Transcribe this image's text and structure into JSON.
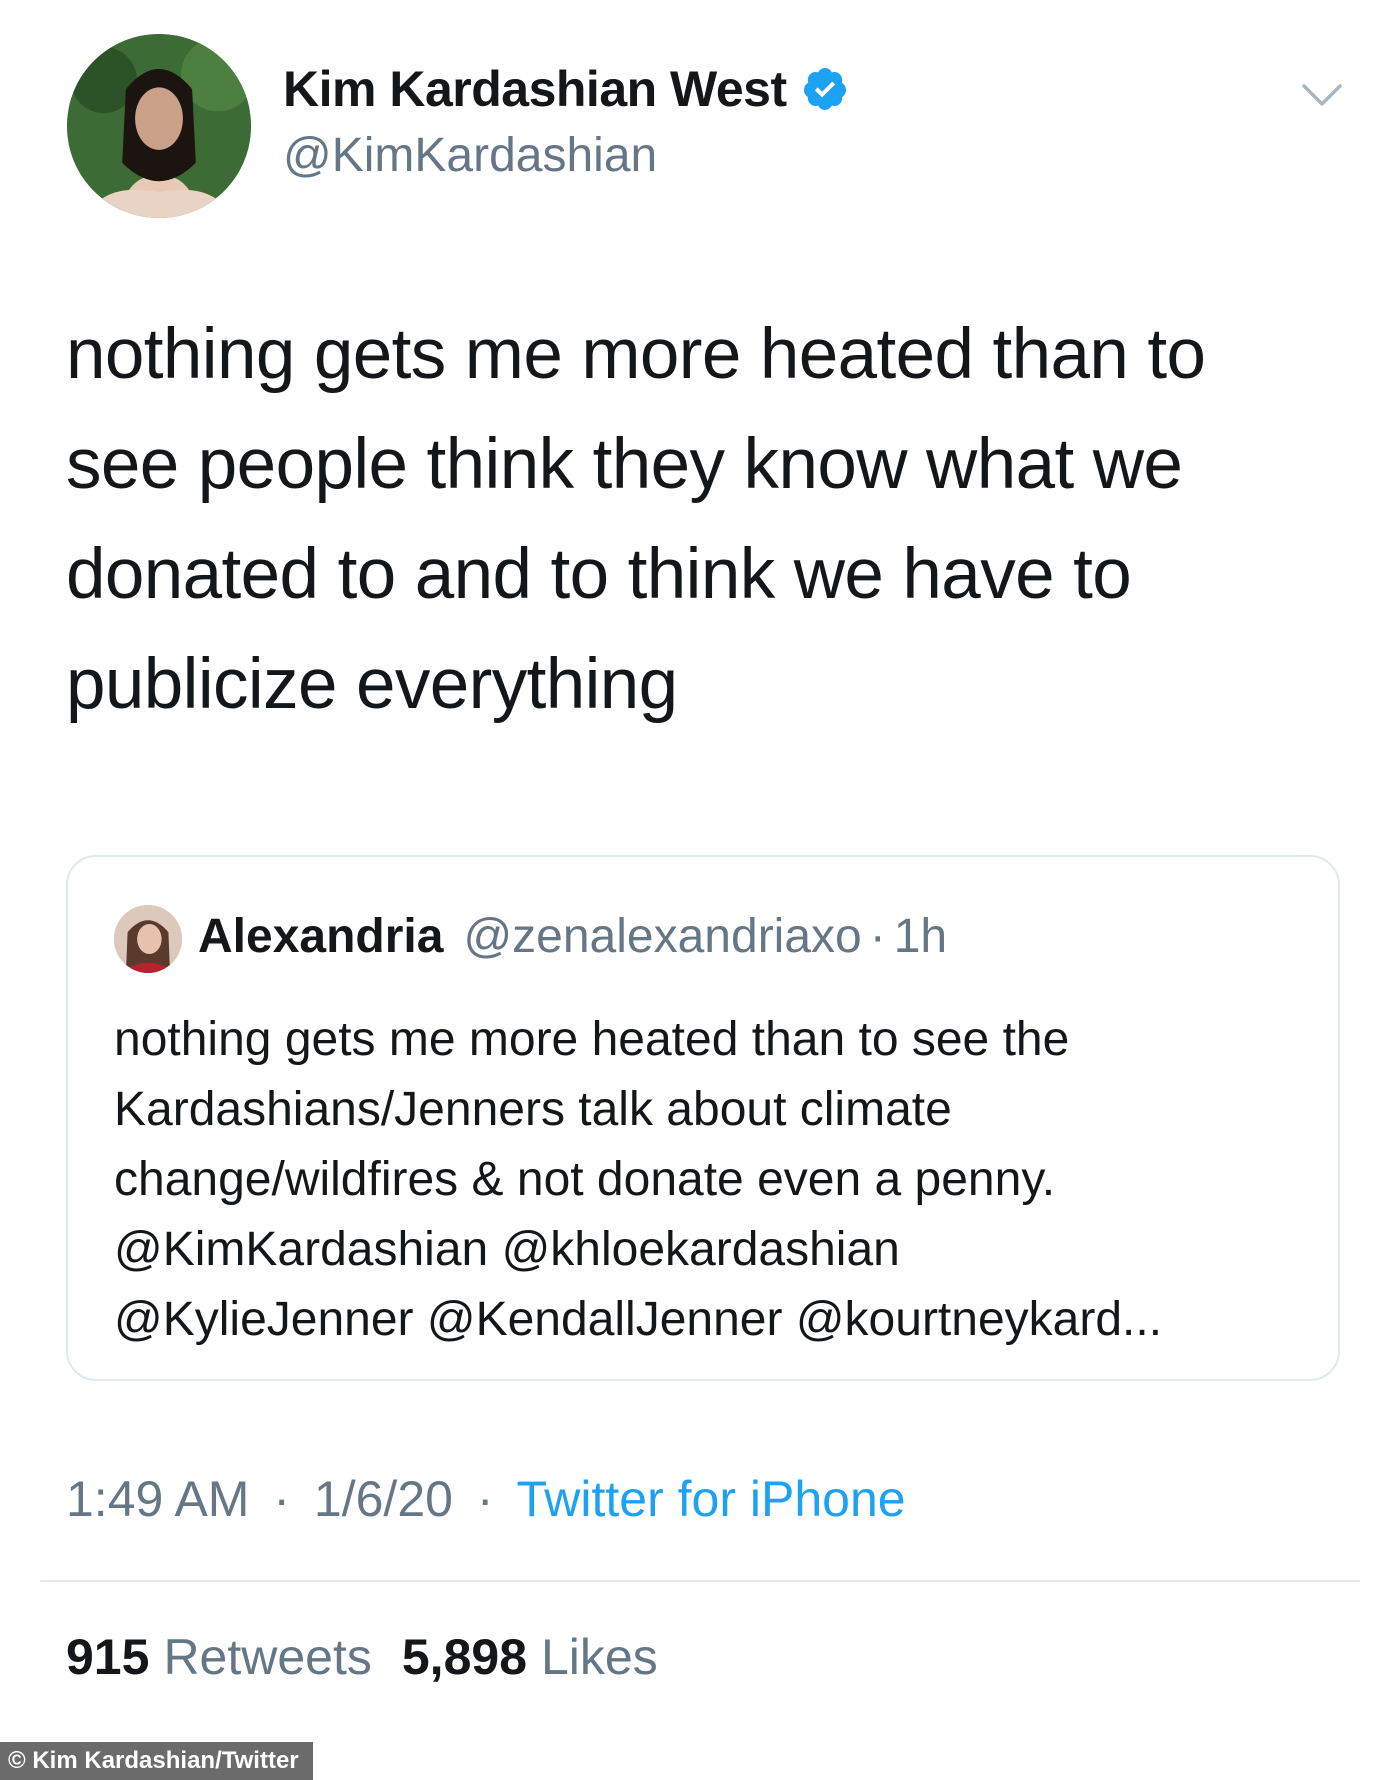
{
  "tweet": {
    "author": {
      "display_name": "Kim Kardashian West",
      "handle": "@KimKardashian",
      "verified": true
    },
    "text_lines": [
      "nothing gets me more heated than to",
      "see people think they know what we",
      "donated to and to think we have to",
      "publicize everything"
    ],
    "quoted": {
      "author_name": "Alexandria",
      "author_handle": "@zenalexandriaxo",
      "separator": "·",
      "time_ago": "1h",
      "text_lines": [
        "nothing gets me more heated than to see the",
        "Kardashians/Jenners talk about climate",
        "change/wildfires & not donate even a penny.",
        "@KimKardashian @khloekardashian",
        "@KylieJenner @KendallJenner @kourtneykard..."
      ]
    },
    "meta": {
      "time": "1:49 AM",
      "separator": "·",
      "date": "1/6/20",
      "source": "Twitter for iPhone"
    },
    "stats": {
      "retweets_count": "915",
      "retweets_label": "Retweets",
      "likes_count": "5,898",
      "likes_label": "Likes"
    }
  },
  "credit": "© Kim Kardashian/Twitter",
  "colors": {
    "text_primary": "#14171a",
    "text_secondary": "#657786",
    "link_blue": "#1da1f2",
    "border": "#e1e8ed"
  },
  "icons": {
    "verified": "verified-badge-icon",
    "caret": "chevron-down-icon"
  }
}
